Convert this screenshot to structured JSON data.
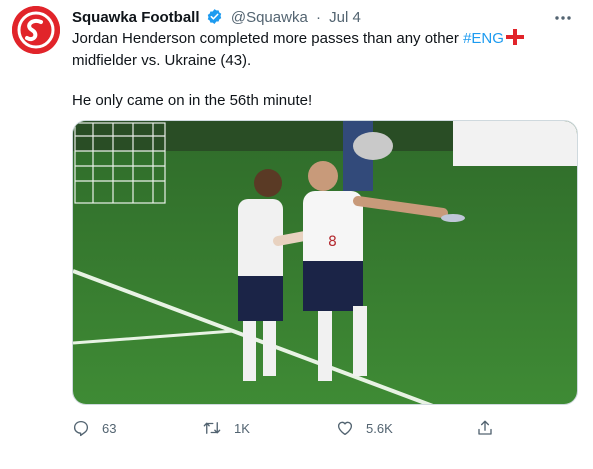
{
  "tweet": {
    "author_name": "Squawka Football",
    "handle": "@Squawka",
    "separator": "·",
    "date": "Jul 4",
    "text_line1_before": "Jordan Henderson completed more passes than any other ",
    "hashtag": "#ENG",
    "text_line1_after": "midfielder vs. Ukraine (43).",
    "text_line2": "He only came on in the 56th minute!",
    "image_alt": "England players celebrating on the pitch",
    "colors": {
      "brand": "#e1242a",
      "link": "#1d9bf0",
      "secondary": "#536471"
    }
  },
  "actions": {
    "reply_count": "63",
    "retweet_count": "1K",
    "like_count": "5.6K"
  },
  "icons": {
    "avatar": "squawka-logo-icon",
    "verified": "verified-badge-icon",
    "more": "more-options-icon",
    "flag": "england-flag-icon",
    "reply": "reply-icon",
    "retweet": "retweet-icon",
    "like": "heart-icon",
    "share": "share-icon"
  }
}
